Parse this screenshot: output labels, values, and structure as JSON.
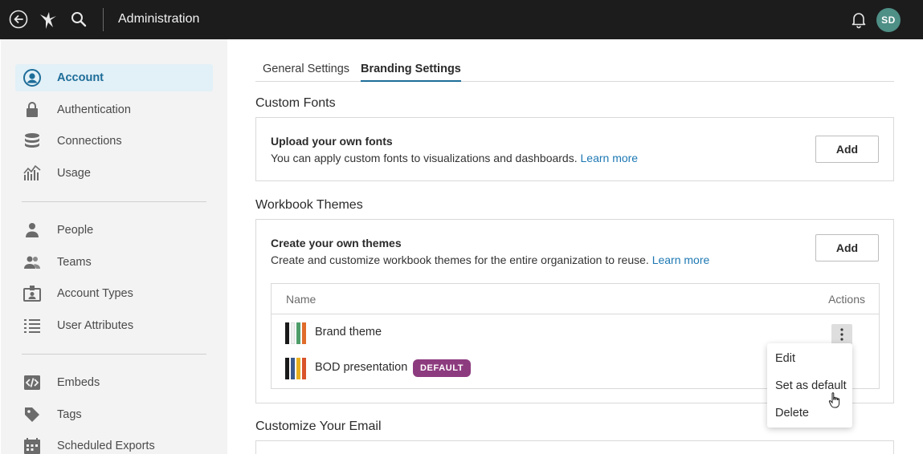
{
  "topbar": {
    "title": "Administration",
    "icons": [
      "back-icon",
      "logo-icon",
      "search-icon",
      "bell-icon"
    ],
    "avatar_initials": "SD",
    "avatar_color": "#4e8f86"
  },
  "sidebar": {
    "groups": [
      [
        {
          "label": "Account",
          "icon": "account-icon",
          "active": true
        },
        {
          "label": "Authentication",
          "icon": "lock-icon"
        },
        {
          "label": "Connections",
          "icon": "database-icon"
        },
        {
          "label": "Usage",
          "icon": "usage-chart-icon"
        }
      ],
      [
        {
          "label": "People",
          "icon": "person-icon"
        },
        {
          "label": "Teams",
          "icon": "team-icon"
        },
        {
          "label": "Account Types",
          "icon": "id-badge-icon"
        },
        {
          "label": "User Attributes",
          "icon": "list-icon"
        }
      ],
      [
        {
          "label": "Embeds",
          "icon": "code-icon"
        },
        {
          "label": "Tags",
          "icon": "tag-icon"
        },
        {
          "label": "Scheduled Exports",
          "icon": "calendar-icon"
        }
      ]
    ]
  },
  "tabs": [
    {
      "label": "General Settings",
      "active": false
    },
    {
      "label": "Branding Settings",
      "active": true
    }
  ],
  "custom_fonts": {
    "section_title": "Custom Fonts",
    "card_title": "Upload your own fonts",
    "description": "You can apply custom fonts to visualizations and dashboards. ",
    "link": "Learn more",
    "button": "Add"
  },
  "workbook_themes": {
    "section_title": "Workbook Themes",
    "card_title": "Create your own themes",
    "description": "Create and customize workbook themes for the entire organization to reuse. ",
    "link": "Learn more",
    "button": "Add",
    "table": {
      "col_name": "Name",
      "col_actions": "Actions",
      "rows": [
        {
          "name": "Brand theme",
          "colors": [
            "#1a1a1a",
            "#f2f2f2",
            "#4f9d6b",
            "#e06b2a"
          ]
        },
        {
          "name": "BOD presentation",
          "badge": "DEFAULT",
          "colors": [
            "#1a1a1a",
            "#3a5a8c",
            "#e8b020",
            "#d9532b"
          ]
        }
      ]
    }
  },
  "context_menu": {
    "items": [
      "Edit",
      "Set as default",
      "Delete"
    ]
  },
  "customize_email": {
    "section_title": "Customize Your Email"
  },
  "colors": {
    "accent": "#1d6d99",
    "link": "#1d78b3",
    "badge": "#8d3b7f",
    "topbar": "#1c1c1c"
  }
}
